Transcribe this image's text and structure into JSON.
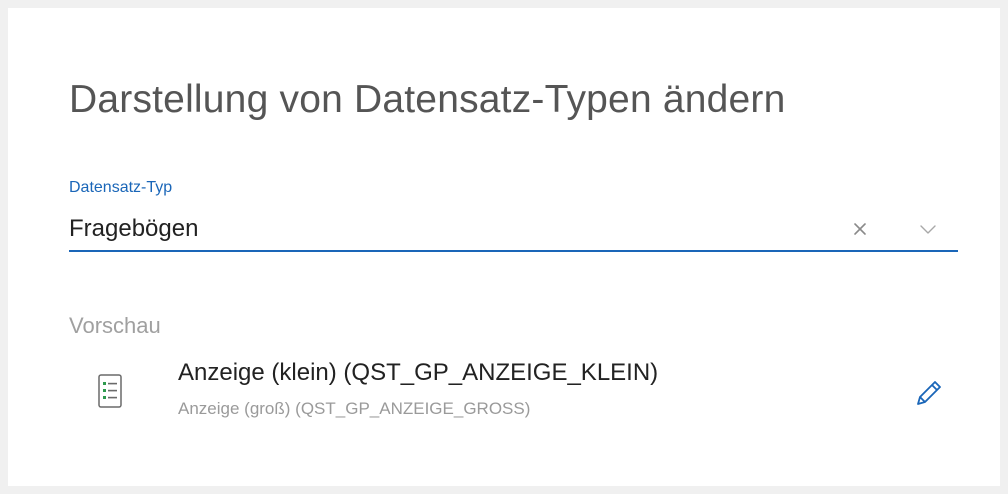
{
  "dialog": {
    "title": "Darstellung von Datensatz-Typen ändern"
  },
  "field": {
    "label": "Datensatz-Typ",
    "value": "Fragebögen",
    "clear_icon": "close-icon",
    "dropdown_icon": "chevron-down-icon",
    "accent_color": "#1a66b8"
  },
  "preview": {
    "label": "Vorschau",
    "item": {
      "icon": "document-list-icon",
      "primary": "Anzeige (klein) (QST_GP_ANZEIGE_KLEIN)",
      "secondary": "Anzeige (groß) (QST_GP_ANZEIGE_GROSS)",
      "edit_icon": "pencil-icon"
    }
  }
}
